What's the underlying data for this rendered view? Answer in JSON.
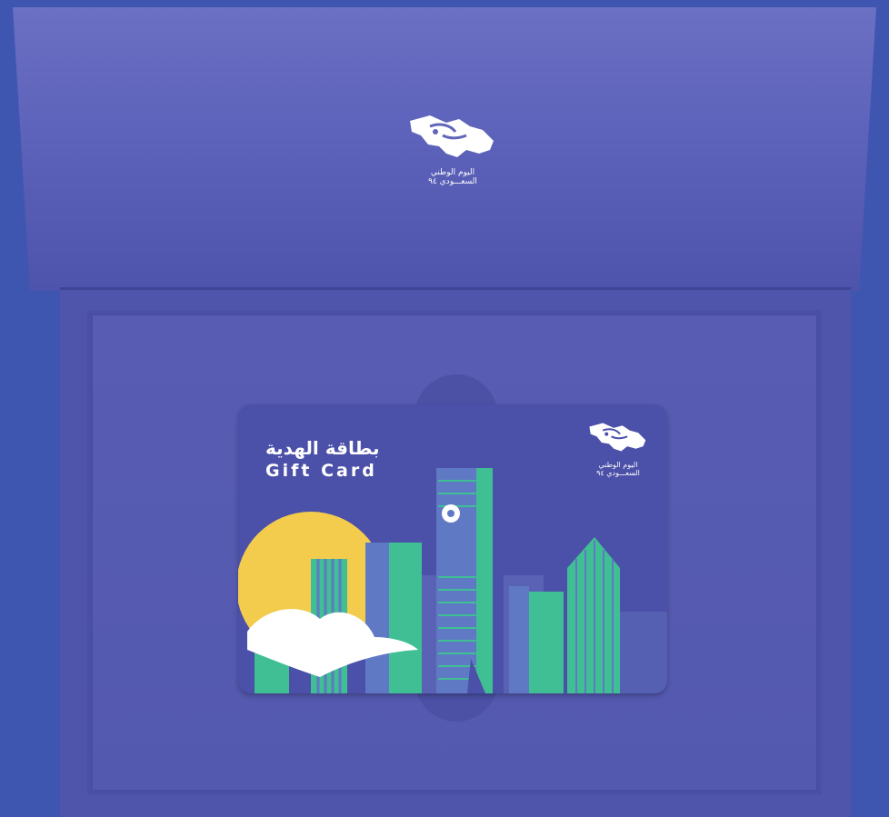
{
  "lid": {
    "emblem_name": "saudi-national-day-emblem",
    "caption_line1": "اليوم الوطني",
    "caption_line2": "السعـــودي ٩٤"
  },
  "card": {
    "title_ar": "بطاقة الهدية",
    "title_en": "Gift Card",
    "emblem_name": "saudi-national-day-emblem",
    "caption_line1": "اليوم الوطني",
    "caption_line2": "السعـــودي ٩٤"
  },
  "colors": {
    "background": "#3f56b0",
    "box": "#5a5fb8",
    "card": "#4b50a8",
    "accent_green": "#3fbf93",
    "sun_yellow": "#f3cc4e",
    "tower_blue": "#5f79c4"
  }
}
